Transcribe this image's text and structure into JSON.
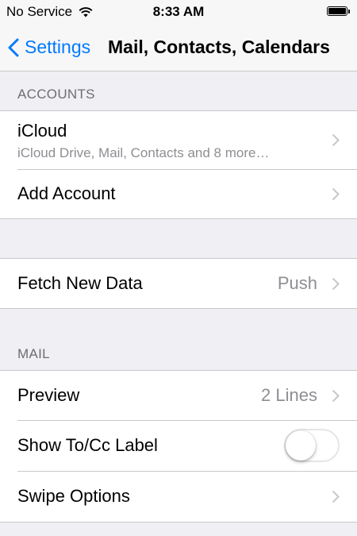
{
  "status_bar": {
    "carrier": "No Service",
    "time": "8:33 AM",
    "wifi_icon": "wifi-icon",
    "battery_icon": "battery-icon"
  },
  "nav": {
    "back_label": "Settings",
    "title": "Mail, Contacts, Calendars",
    "accent_color": "#007aff"
  },
  "sections": {
    "accounts_header": "ACCOUNTS",
    "mail_header": "MAIL"
  },
  "accounts": {
    "icloud_title": "iCloud",
    "icloud_subtitle": "iCloud Drive, Mail, Contacts and 8 more…",
    "add_account": "Add Account"
  },
  "fetch": {
    "label": "Fetch New Data",
    "value": "Push"
  },
  "mail": {
    "preview_label": "Preview",
    "preview_value": "2 Lines",
    "show_tocc_label": "Show To/Cc Label",
    "show_tocc_on": false,
    "swipe_options_label": "Swipe Options"
  }
}
